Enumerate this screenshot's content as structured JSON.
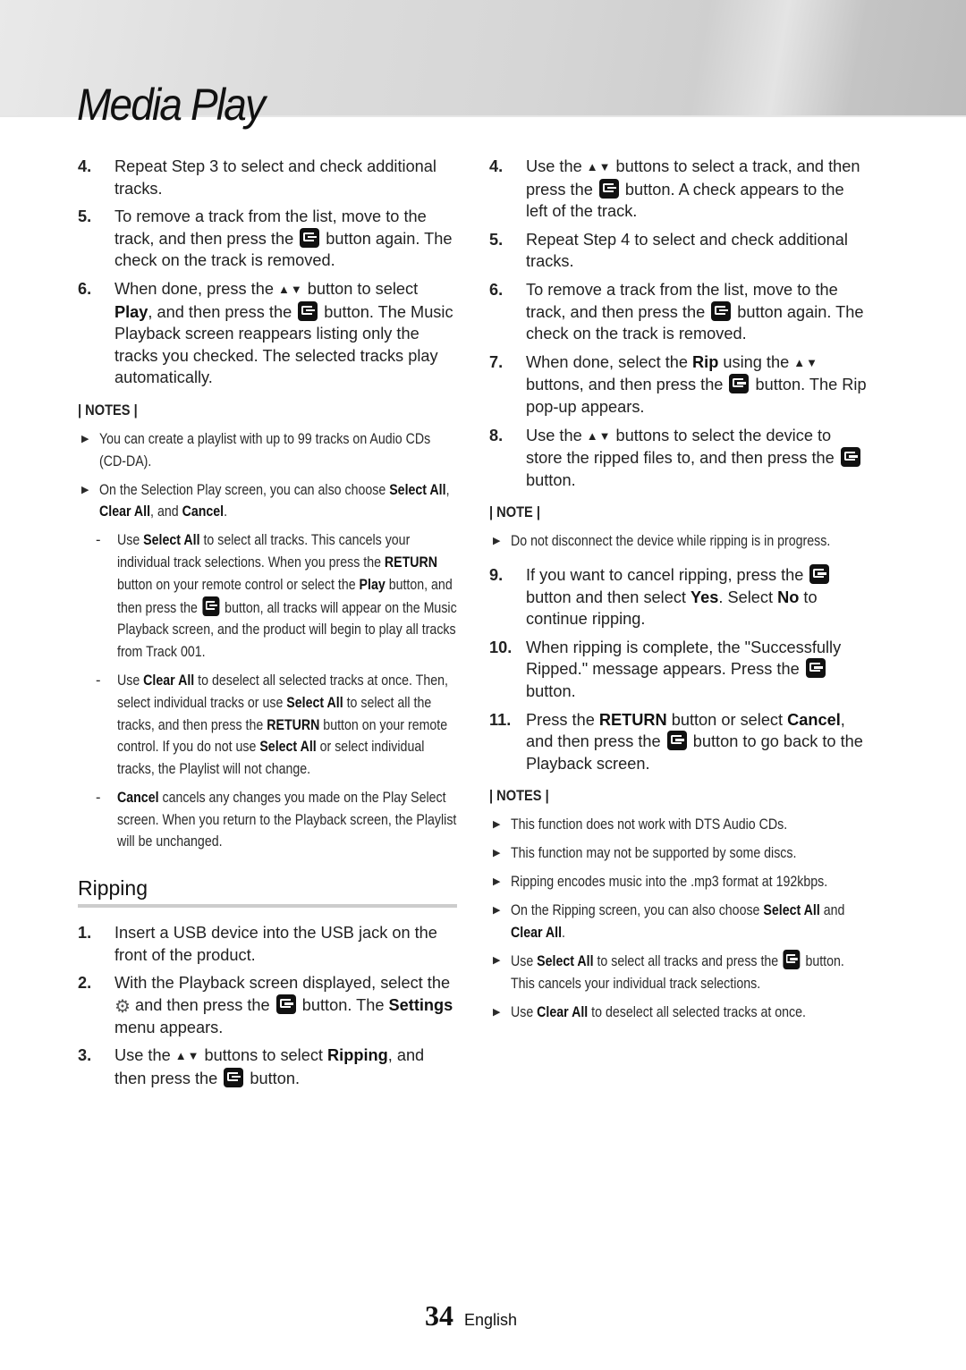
{
  "header": {
    "title": "Media Play"
  },
  "left_column": {
    "steps_top": [
      {
        "num": "4.",
        "parts": [
          {
            "t": "Repeat Step 3 to select and check additional tracks."
          }
        ]
      },
      {
        "num": "5.",
        "parts": [
          {
            "t": "To remove a track from the list, move to the track, and then press the "
          },
          {
            "icon": "enter"
          },
          {
            "t": " button again. The check on the track is removed."
          }
        ]
      },
      {
        "num": "6.",
        "parts": [
          {
            "t": "When done, press the "
          },
          {
            "icon": "updown"
          },
          {
            "t": " button to select "
          },
          {
            "b": "Play"
          },
          {
            "t": ", and then press the "
          },
          {
            "icon": "enter"
          },
          {
            "t": " button. The Music Playback screen reappears listing only the tracks you checked. The selected tracks play automatically."
          }
        ]
      }
    ],
    "notes_label": "| NOTES |",
    "notes": [
      {
        "parts": [
          {
            "t": "You can create a playlist with up to 99 tracks on Audio CDs (CD-DA)."
          }
        ]
      },
      {
        "parts": [
          {
            "t": "On the Selection Play screen, you can also choose "
          },
          {
            "b": "Select All"
          },
          {
            "t": ", "
          },
          {
            "b": "Clear All"
          },
          {
            "t": ", and "
          },
          {
            "b": "Cancel"
          },
          {
            "t": "."
          }
        ]
      }
    ],
    "sub_notes": [
      {
        "parts": [
          {
            "t": "Use "
          },
          {
            "b": "Select All"
          },
          {
            "t": " to select all tracks. This cancels your individual track selections. When you press the "
          },
          {
            "b": "RETURN"
          },
          {
            "t": " button on your remote control or select the "
          },
          {
            "b": "Play"
          },
          {
            "t": " button, and then press the "
          },
          {
            "icon": "enter"
          },
          {
            "t": " button, all tracks will appear on the Music Playback screen, and the product will begin to play all tracks from Track 001."
          }
        ]
      },
      {
        "parts": [
          {
            "t": "Use "
          },
          {
            "b": "Clear All"
          },
          {
            "t": " to deselect all selected tracks at once. Then, select individual tracks or use "
          },
          {
            "b": "Select All"
          },
          {
            "t": " to select all the tracks, and then press the "
          },
          {
            "b": "RETURN"
          },
          {
            "t": " button on your remote control. If you do not use "
          },
          {
            "b": "Select All"
          },
          {
            "t": " or select individual tracks, the Playlist will not change."
          }
        ]
      },
      {
        "parts": [
          {
            "b": "Cancel"
          },
          {
            "t": " cancels any changes you made on the Play Select screen. When you return to the Playback screen, the Playlist will be unchanged."
          }
        ]
      }
    ],
    "section_title": "Ripping",
    "ripping_steps": [
      {
        "num": "1.",
        "parts": [
          {
            "t": "Insert a USB device into the USB jack on the front of the product."
          }
        ]
      },
      {
        "num": "2.",
        "parts": [
          {
            "t": "With the Playback screen displayed, select the "
          },
          {
            "icon": "gear"
          },
          {
            "t": " and then press the "
          },
          {
            "icon": "enter"
          },
          {
            "t": " button. The "
          },
          {
            "b": "Settings"
          },
          {
            "t": " menu appears."
          }
        ]
      },
      {
        "num": "3.",
        "parts": [
          {
            "t": "Use the "
          },
          {
            "icon": "updown"
          },
          {
            "t": " buttons to select "
          },
          {
            "b": "Ripping"
          },
          {
            "t": ", and then press the "
          },
          {
            "icon": "enter"
          },
          {
            "t": " button."
          }
        ]
      }
    ]
  },
  "right_column": {
    "steps_a": [
      {
        "num": "4.",
        "parts": [
          {
            "t": "Use the "
          },
          {
            "icon": "updown"
          },
          {
            "t": " buttons to select a track, and then press the "
          },
          {
            "icon": "enter"
          },
          {
            "t": " button. A check appears to the left of the track."
          }
        ]
      },
      {
        "num": "5.",
        "parts": [
          {
            "t": "Repeat Step 4 to select and check additional tracks."
          }
        ]
      },
      {
        "num": "6.",
        "parts": [
          {
            "t": "To remove a track from the list, move to the track, and then press the "
          },
          {
            "icon": "enter"
          },
          {
            "t": " button again. The check on the track is removed."
          }
        ]
      },
      {
        "num": "7.",
        "parts": [
          {
            "t": "When done, select the "
          },
          {
            "b": "Rip"
          },
          {
            "t": " using the "
          },
          {
            "icon": "updown"
          },
          {
            "t": " buttons, and then press the "
          },
          {
            "icon": "enter"
          },
          {
            "t": " button. The Rip pop-up appears."
          }
        ]
      },
      {
        "num": "8.",
        "parts": [
          {
            "t": "Use the "
          },
          {
            "icon": "updown"
          },
          {
            "t": " buttons to select the device to store the ripped files to, and then press the "
          },
          {
            "icon": "enter"
          },
          {
            "t": " button."
          }
        ]
      }
    ],
    "note_label": "| NOTE |",
    "note": [
      {
        "parts": [
          {
            "t": "Do not disconnect the device while ripping is in progress."
          }
        ]
      }
    ],
    "steps_b": [
      {
        "num": "9.",
        "parts": [
          {
            "t": "If you want to cancel ripping, press the "
          },
          {
            "icon": "enter"
          },
          {
            "t": " button and then select "
          },
          {
            "b": "Yes"
          },
          {
            "t": ". Select "
          },
          {
            "b": "No"
          },
          {
            "t": " to continue ripping."
          }
        ]
      },
      {
        "num": "10.",
        "parts": [
          {
            "t": "When ripping is complete, the \"Successfully Ripped.\" message appears. Press the "
          },
          {
            "icon": "enter"
          },
          {
            "t": " button."
          }
        ]
      },
      {
        "num": "11.",
        "parts": [
          {
            "t": "Press the "
          },
          {
            "b": "RETURN"
          },
          {
            "t": " button or select "
          },
          {
            "b": "Cancel"
          },
          {
            "t": ", and then press the "
          },
          {
            "icon": "enter"
          },
          {
            "t": " button to go back to the Playback screen."
          }
        ]
      }
    ],
    "notes_label": "| NOTES |",
    "notes": [
      {
        "parts": [
          {
            "t": "This function does not work with DTS Audio CDs."
          }
        ]
      },
      {
        "parts": [
          {
            "t": "This function may not be supported by some discs."
          }
        ]
      },
      {
        "parts": [
          {
            "t": "Ripping encodes music into the .mp3 format at 192kbps."
          }
        ]
      },
      {
        "parts": [
          {
            "t": "On the Ripping screen, you can also choose "
          },
          {
            "b": "Select All"
          },
          {
            "t": " and "
          },
          {
            "b": "Clear All"
          },
          {
            "t": "."
          }
        ]
      },
      {
        "parts": [
          {
            "t": "Use "
          },
          {
            "b": "Select All"
          },
          {
            "t": " to select all tracks and press the "
          },
          {
            "icon": "enter"
          },
          {
            "t": " button. This cancels your individual track selections."
          }
        ]
      },
      {
        "parts": [
          {
            "t": "Use "
          },
          {
            "b": "Clear All"
          },
          {
            "t": " to deselect all selected tracks at once."
          }
        ]
      }
    ]
  },
  "icons": {
    "enter": "enter-button-icon",
    "updown": "up-down-arrows-icon",
    "gear": "gear-settings-icon",
    "bullet": "triangle-bullet-icon"
  },
  "glyphs": {
    "updown": "▲▼",
    "gear": "⚙",
    "bullet": "▶",
    "dash": "-"
  },
  "footer": {
    "page_number": "34",
    "language": "English"
  }
}
